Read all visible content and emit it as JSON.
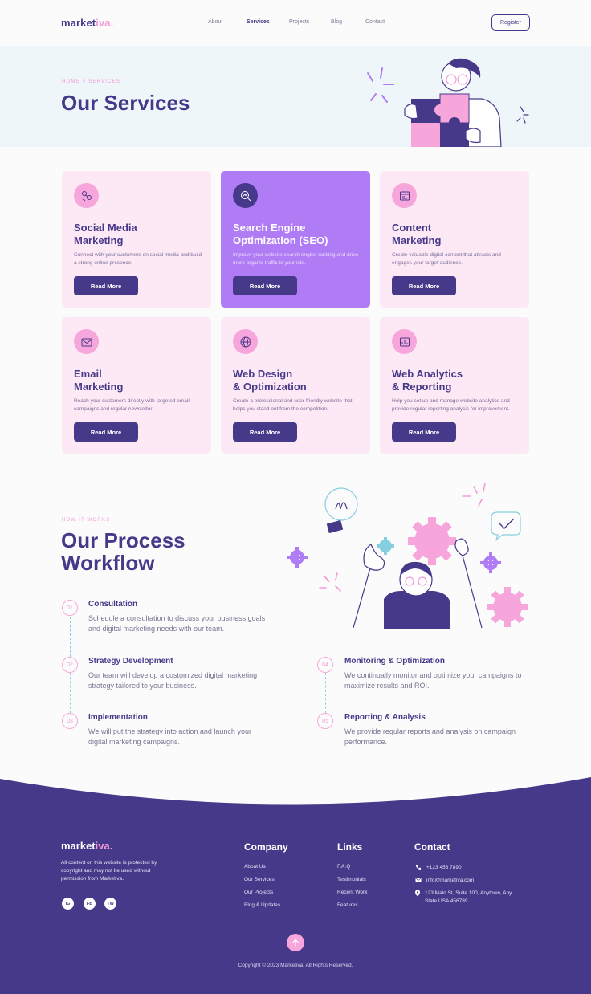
{
  "brand": {
    "name_main": "market",
    "name_accent": "iva."
  },
  "nav": {
    "items": [
      {
        "label": "About"
      },
      {
        "label": "Services"
      },
      {
        "label": "Projects"
      },
      {
        "label": "Blog"
      },
      {
        "label": "Contact"
      }
    ],
    "active": "Services",
    "register_label": "Register"
  },
  "hero": {
    "breadcrumb": "HOME > SERVICES",
    "title": "Our Services"
  },
  "services": [
    {
      "title": "Social Media\nMarketing",
      "desc": "Connect with your customers on social media and build a strong online presence.",
      "button": "Read More",
      "icon": "social-media-icon"
    },
    {
      "title": "Search Engine\nOptimization (SEO)",
      "desc": "Improve your website search engine ranking and drive more organic traffic to your site.",
      "button": "Read More",
      "icon": "seo-icon"
    },
    {
      "title": "Content\nMarketing",
      "desc": "Create valuable digital content that attracts and engages your target audience.",
      "button": "Read More",
      "icon": "content-icon"
    },
    {
      "title": "Email\nMarketing",
      "desc": "Reach your customers directly with targeted email campaigns and regular newsletter.",
      "button": "Read More",
      "icon": "email-icon"
    },
    {
      "title": "Web Design\n& Optimization",
      "desc": "Create a professional and user-friendly website that helps you stand out from the competition.",
      "button": "Read More",
      "icon": "globe-icon"
    },
    {
      "title": "Web Analytics\n& Reporting",
      "desc": "Help you set up and manage website analytics and provide regular reporting analysis for improvement.",
      "button": "Read More",
      "icon": "analytics-icon"
    }
  ],
  "process": {
    "eyebrow": "HOW IT WORKS",
    "title": "Our Process Workflow",
    "steps": [
      {
        "num": "01",
        "title": "Consultation",
        "desc": "Schedule a consultation to discuss your business goals and digital marketing needs with our team."
      },
      {
        "num": "02",
        "title": "Strategy Development",
        "desc": "Our team will develop a customized digital marketing strategy tailored to your business."
      },
      {
        "num": "03",
        "title": "Implementation",
        "desc": "We will put the strategy into action and launch your digital marketing campaigns."
      },
      {
        "num": "04",
        "title": "Monitoring & Optimization",
        "desc": "We continually monitor and optimize your campaigns to maximize results and ROI."
      },
      {
        "num": "05",
        "title": "Reporting & Analysis",
        "desc": "We provide regular reports and analysis on campaign performance."
      }
    ]
  },
  "footer": {
    "brand_main": "market",
    "brand_accent": "iva.",
    "desc": "All content on this website is protected by copyright and may not be used without permission from Marketiva.",
    "social": [
      "IG",
      "FB",
      "TW"
    ],
    "company": {
      "title": "Company",
      "links": [
        "About Us",
        "Our Services",
        "Our Projects",
        "Blog & Updates"
      ]
    },
    "links": {
      "title": "Links",
      "links": [
        "F.A.Q",
        "Testimonials",
        "Recent Work",
        "Features"
      ]
    },
    "contact": {
      "title": "Contact",
      "phone": "+123 456 7890",
      "email": "info@marketiva.com",
      "address": "123 Main St, Suite 100, Anytown, Any State USA 456789"
    },
    "copyright": "Copyright © 2023 Marketiva. All Rights Reserved."
  },
  "colors": {
    "primary": "#47398a",
    "accent_pink": "#f29bd6",
    "card_bg": "#fde9f6",
    "featured": "#b07cf5",
    "hero_bg": "#eff6f9"
  }
}
